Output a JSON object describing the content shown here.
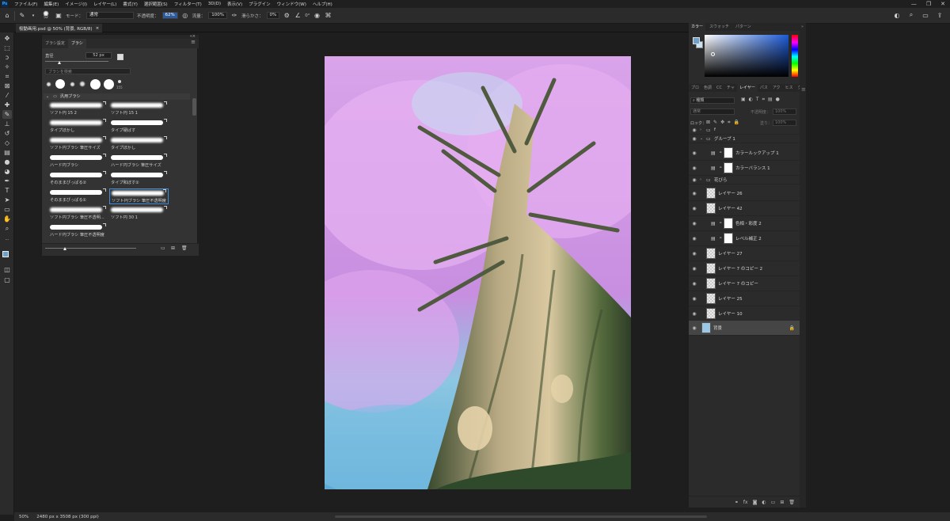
{
  "menubar": {
    "logo": "Ps",
    "items": [
      "ファイル(F)",
      "編集(E)",
      "イメージ(I)",
      "レイヤー(L)",
      "書式(Y)",
      "選択範囲(S)",
      "フィルター(T)",
      "3D(D)",
      "表示(V)",
      "プラグイン",
      "ウィンドウ(W)",
      "ヘルプ(H)"
    ],
    "window_controls": [
      "—",
      "❐",
      "✕"
    ]
  },
  "options": {
    "brush_size": "52",
    "mode_label": "モード：",
    "mode_value": "通常",
    "opacity_label": "不透明度：",
    "opacity_value": "62%",
    "flow_label": "流量：",
    "flow_value": "100%",
    "smoothing_label": "滑らかさ：",
    "smoothing_value": "0%",
    "angle_value": "0°"
  },
  "document": {
    "tab_title": "桜動画用.psd @ 50% (背景, RGB/8)",
    "close": "×"
  },
  "brush_panel": {
    "tabs": [
      "ブラシ設定",
      "ブラシ"
    ],
    "size_label": "直径",
    "size_value": "52 px",
    "search_placeholder": "ブラシを検索",
    "preset_last_label": "155",
    "folder_name": "汎用ブラシ",
    "brushes": [
      {
        "name": "ソフト円 15 2",
        "soft": true
      },
      {
        "name": "ソフト円 15 1",
        "soft": true
      },
      {
        "name": "タイプぼかし",
        "soft": true
      },
      {
        "name": "タイプ硬ばす",
        "soft": false
      },
      {
        "name": "ソフト円ブラシ 筆圧サイズ",
        "soft": true
      },
      {
        "name": "タイプぼかし",
        "soft": true
      },
      {
        "name": "ハード円ブラシ",
        "soft": false
      },
      {
        "name": "ハード円ブラシ 筆圧サイズ",
        "soft": false
      },
      {
        "name": "そのままぴっぱる②",
        "soft": false
      },
      {
        "name": "タイプ和ぼす②",
        "soft": false
      },
      {
        "name": "そのままぴっぱる①",
        "soft": false
      },
      {
        "name": "ソフト円ブラシ 筆圧不透明度",
        "soft": true
      },
      {
        "name": "ソフト円ブラシ 筆圧不透明...",
        "soft": true
      },
      {
        "name": "ソフト円 30 1",
        "soft": true
      },
      {
        "name": "ハード円ブラシ 筆圧不透明度",
        "soft": false
      }
    ]
  },
  "color_panel": {
    "tabs": [
      "カラー",
      "スウォッチ",
      "パターン"
    ],
    "fg_color": "#6fa0c9",
    "bg_color": "#c8e4f4"
  },
  "layers_panel": {
    "tabs": [
      "プロ",
      "色調",
      "CC",
      "チャ",
      "レイヤー",
      "パス",
      "アク",
      "ヒス",
      "グラ"
    ],
    "filter_label": "種類",
    "blend_mode": "通常",
    "opacity_label": "不透明度：",
    "opacity_value": "100%",
    "lock_label": "ロック：",
    "fill_label": "塗り：",
    "fill_value": "100%",
    "layers": [
      {
        "name": "f",
        "kind": "folder"
      },
      {
        "name": "グループ 1",
        "kind": "folder-open"
      },
      {
        "name": "カラールックアップ 1",
        "kind": "adjust"
      },
      {
        "name": "カラーバランス 1",
        "kind": "adjust"
      },
      {
        "name": "花びら",
        "kind": "folder"
      },
      {
        "name": "レイヤー 26",
        "kind": "pixel"
      },
      {
        "name": "レイヤー 42",
        "kind": "pixel"
      },
      {
        "name": "色相・彩度 2",
        "kind": "adjust"
      },
      {
        "name": "レベル補正 2",
        "kind": "adjust"
      },
      {
        "name": "レイヤー 27",
        "kind": "pixel"
      },
      {
        "name": "レイヤー 7 のコピー 2",
        "kind": "pixel"
      },
      {
        "name": "レイヤー 7 のコピー",
        "kind": "pixel"
      },
      {
        "name": "レイヤー 25",
        "kind": "pixel"
      },
      {
        "name": "レイヤー 10",
        "kind": "pixel"
      },
      {
        "name": "背景",
        "kind": "background"
      }
    ]
  },
  "status": {
    "zoom": "50%",
    "doc_size": "2480 px x 3508 px (300 ppi)"
  }
}
